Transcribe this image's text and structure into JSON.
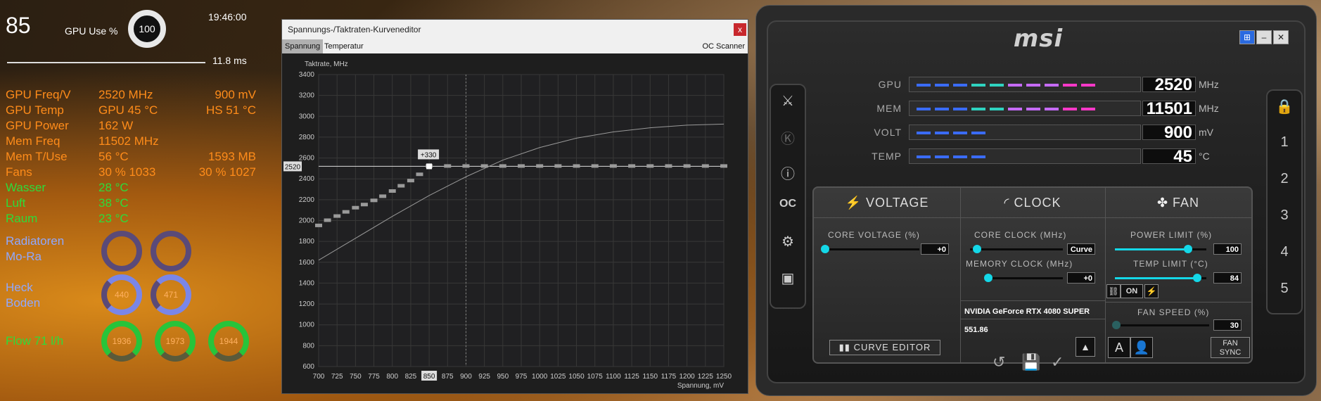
{
  "osd": {
    "fps": "85",
    "gpu_use_label": "GPU Use %",
    "gpu_use_value": "100",
    "clock": "19:46:00",
    "frametime": "11.8 ms",
    "rows": [
      {
        "c1": "GPU Freq/V",
        "c2": "2520 MHz",
        "c3": "900 mV",
        "color": "orange"
      },
      {
        "c1": "GPU Temp",
        "c2": "GPU 45 °C",
        "c3": "HS 51 °C",
        "color": "orange"
      },
      {
        "c1": "GPU Power",
        "c2": "162 W",
        "c3": "",
        "color": "orange"
      },
      {
        "c1": "Mem Freq",
        "c2": "11502 MHz",
        "c3": "",
        "color": "orange"
      },
      {
        "c1": "Mem T/Use",
        "c2": "56 °C",
        "c3": "1593 MB",
        "color": "orange"
      },
      {
        "c1": "Fans",
        "c2": "30 %  1033",
        "c3": "30 % 1027",
        "color": "orange"
      },
      {
        "c1": "Wasser",
        "c2": "28 °C",
        "c3": "",
        "color": "green"
      },
      {
        "c1": "Luft",
        "c2": "38 °C",
        "c3": "",
        "color": "green"
      },
      {
        "c1": "Raum",
        "c2": "23 °C",
        "c3": "",
        "color": "green"
      }
    ],
    "radiatoren": "Radiatoren",
    "mora": "Mo-Ra",
    "heck": "Heck",
    "boden": "Boden",
    "flow": "Flow 71 l/h",
    "dial_heck": "440",
    "dial_boden": "471",
    "dial_flow1": "1936",
    "dial_flow2": "1973",
    "dial_flow3": "1944"
  },
  "curve_editor": {
    "title": "Spannungs-/Taktraten-Kurveneditor",
    "close": "x",
    "tab_voltage": "Spannung",
    "tab_temp": "Temperatur",
    "oc_scanner": "OC Scanner",
    "y_axis_label": "Taktrate, MHz",
    "x_axis_label": "Spannung, mV",
    "selected_point_label": "+330",
    "current_freq_label": "2520",
    "current_volt_label": "850"
  },
  "chart_data": {
    "type": "line",
    "title": "",
    "xlabel": "Spannung, mV",
    "ylabel": "Taktrate, MHz",
    "xlim": [
      700,
      1250
    ],
    "ylim": [
      600,
      3400
    ],
    "x_ticks": [
      700,
      725,
      750,
      775,
      800,
      825,
      850,
      875,
      900,
      925,
      950,
      975,
      1000,
      1025,
      1050,
      1075,
      1100,
      1125,
      1150,
      1175,
      1200,
      1225,
      1250
    ],
    "y_ticks": [
      600,
      800,
      1000,
      1200,
      1400,
      1600,
      1800,
      2000,
      2200,
      2400,
      2600,
      2800,
      3000,
      3200,
      3400
    ],
    "series": [
      {
        "name": "",
        "style": "curve-points",
        "x": [
          700,
          712,
          725,
          737,
          750,
          762,
          775,
          787,
          800,
          812,
          825,
          837,
          850,
          875,
          900,
          925,
          950,
          975,
          1000,
          1025,
          1050,
          1075,
          1100,
          1125,
          1150,
          1175,
          1200,
          1225,
          1250
        ],
        "y": [
          1950,
          2000,
          2040,
          2080,
          2120,
          2150,
          2190,
          2230,
          2280,
          2330,
          2380,
          2440,
          2520,
          2520,
          2520,
          2520,
          2520,
          2520,
          2520,
          2520,
          2520,
          2520,
          2520,
          2520,
          2520,
          2520,
          2520,
          2520,
          2520
        ]
      },
      {
        "name": "",
        "style": "thin-line",
        "x": [
          700,
          750,
          800,
          850,
          900,
          950,
          1000,
          1050,
          1100,
          1150,
          1200,
          1250
        ],
        "y": [
          1620,
          1830,
          2040,
          2240,
          2420,
          2580,
          2700,
          2790,
          2850,
          2890,
          2915,
          2925
        ]
      }
    ],
    "grid": true,
    "highlight": {
      "x": 850,
      "y": 2520,
      "offset_label": "+330"
    }
  },
  "afterburner": {
    "logo": "msi",
    "win_buttons": [
      "⊞",
      "–",
      "✕"
    ],
    "monitors": [
      {
        "label": "GPU",
        "value": "2520",
        "unit": "MHz",
        "fill": 0.88,
        "colors": [
          "#3a6cff",
          "#2fd3c0",
          "#c66bff",
          "#ff38c8"
        ]
      },
      {
        "label": "MEM",
        "value": "11501",
        "unit": "MHz",
        "fill": 0.88,
        "colors": [
          "#3a6cff",
          "#2fd3c0",
          "#c66bff",
          "#ff38c8"
        ]
      },
      {
        "label": "VOLT",
        "value": "900",
        "unit": "mV",
        "fill": 0.34,
        "colors": [
          "#3a6cff"
        ]
      },
      {
        "label": "TEMP",
        "value": "45",
        "unit": "°C",
        "fill": 0.34,
        "colors": [
          "#3a6cff"
        ]
      }
    ],
    "voltage_head": "VOLTAGE",
    "clock_head": "CLOCK",
    "fan_head": "FAN",
    "core_voltage_label": "CORE VOLTAGE  (%)",
    "core_voltage_value": "+0",
    "core_clock_label": "CORE CLOCK (MHz)",
    "core_clock_value": "Curve",
    "memory_clock_label": "MEMORY CLOCK (MHz)",
    "memory_clock_value": "+0",
    "power_limit_label": "POWER LIMIT (%)",
    "power_limit_value": "100",
    "power_limit_level": 0.8,
    "temp_limit_label": "TEMP LIMIT (°C)",
    "temp_limit_value": "84",
    "temp_limit_level": 0.9,
    "link_on": "ON",
    "fan_speed_label": "FAN SPEED (%)",
    "fan_speed_value": "30",
    "gpu_name": "NVIDIA GeForce RTX 4080 SUPER",
    "driver": "551.86",
    "curve_editor_btn": "CURVE EDITOR",
    "fan_sync_1": "FAN",
    "fan_sync_2": "SYNC",
    "profiles": [
      "1",
      "2",
      "3",
      "4",
      "5"
    ]
  }
}
